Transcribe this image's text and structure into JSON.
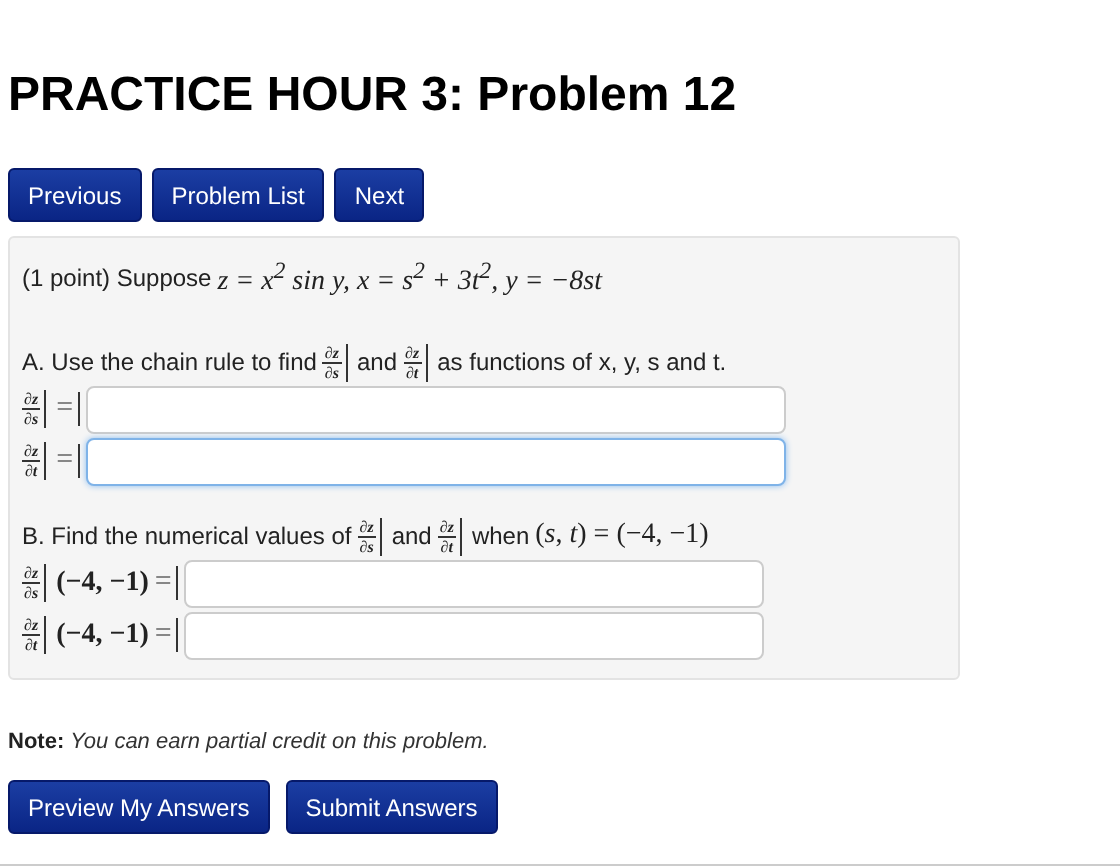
{
  "title": "PRACTICE HOUR 3: Problem 12",
  "nav_buttons": [
    "Previous",
    "Problem List",
    "Next"
  ],
  "statement": {
    "intro": "(1 point) Suppose",
    "math": "z = x$^{2}$ sin y, x = s$^{2}$ + 3t$^{2}$, y = −8st"
  },
  "part_a": {
    "segments": [
      {
        "kind": "text",
        "text": "A. Use the chain rule to find"
      },
      {
        "kind": "frac",
        "num": "∂z",
        "den": "∂s"
      },
      {
        "kind": "text",
        "text": "and"
      },
      {
        "kind": "frac",
        "num": "∂z",
        "den": "∂t"
      },
      {
        "kind": "text",
        "text": "as functions of x, y, s and t."
      }
    ],
    "answers": [
      {
        "num": "∂z",
        "den": "∂s",
        "equals": "=",
        "focused": false
      },
      {
        "num": "∂z",
        "den": "∂t",
        "equals": "=",
        "focused": true
      }
    ]
  },
  "part_b": {
    "segments": [
      {
        "kind": "text",
        "text": "B. Find the numerical values of"
      },
      {
        "kind": "frac",
        "num": "∂z",
        "den": "∂s"
      },
      {
        "kind": "text",
        "text": "and"
      },
      {
        "kind": "frac",
        "num": "∂z",
        "den": "∂t"
      },
      {
        "kind": "text",
        "text": "when"
      },
      {
        "kind": "math",
        "text": "(*s*, *t*) = (−4, −1)"
      }
    ],
    "answers": [
      {
        "num": "∂z",
        "den": "∂s",
        "point": "(−4, −1)",
        "equals": "=",
        "focused": false
      },
      {
        "num": "∂z",
        "den": "∂t",
        "point": "(−4, −1)",
        "equals": "=",
        "focused": false
      }
    ]
  },
  "note": {
    "label": "Note:",
    "text": "You can earn partial credit on this problem."
  },
  "submit_buttons": [
    "Preview My Answers",
    "Submit Answers"
  ]
}
